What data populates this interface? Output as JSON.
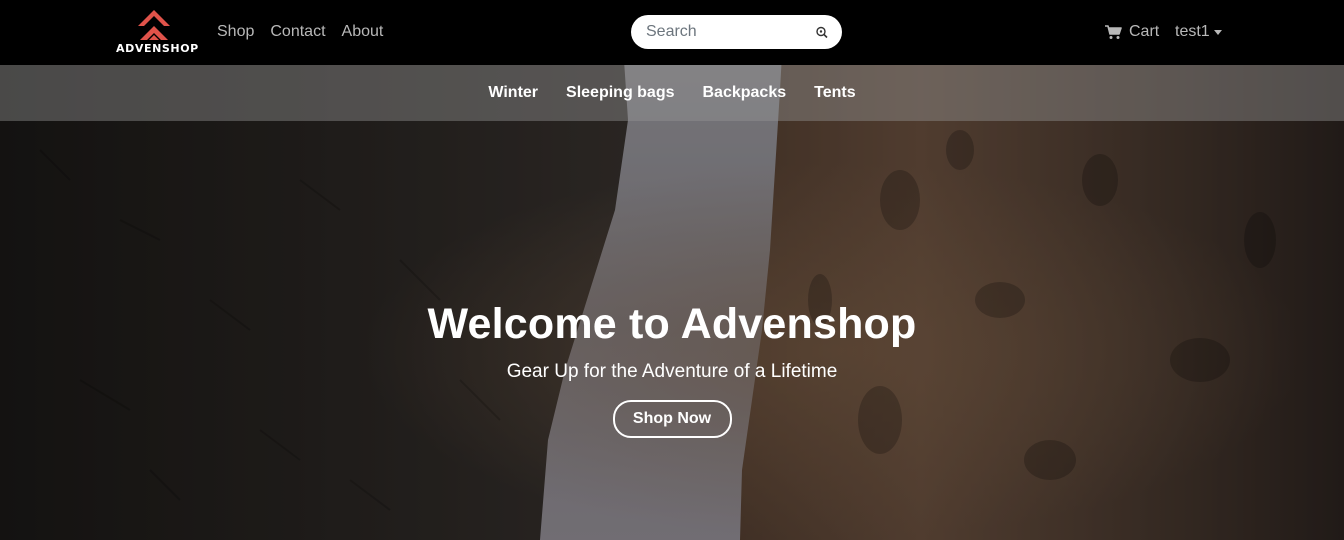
{
  "brand": {
    "name": "ADVENSHOP",
    "accent_color": "#e0534a"
  },
  "nav": {
    "links": [
      "Shop",
      "Contact",
      "About"
    ]
  },
  "search": {
    "placeholder": "Search",
    "value": "",
    "icon": "search-icon"
  },
  "cart": {
    "label": "Cart",
    "icon": "cart-icon"
  },
  "user": {
    "name": "test1",
    "icon": "caret-down-icon"
  },
  "categories": [
    "Winter",
    "Sleeping bags",
    "Backpacks",
    "Tents"
  ],
  "hero": {
    "title": "Welcome to Advenshop",
    "subtitle": "Gear Up for the Adventure of a Lifetime",
    "cta_label": "Shop Now"
  }
}
